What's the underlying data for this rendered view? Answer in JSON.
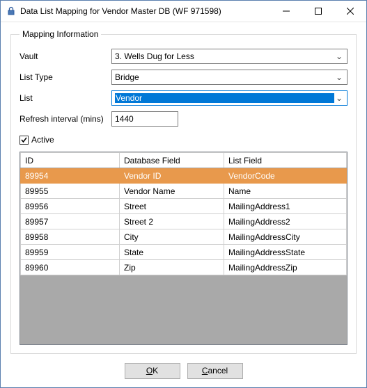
{
  "window": {
    "title": "Data List Mapping for Vendor Master DB (WF 971598)"
  },
  "group": {
    "legend": "Mapping Information"
  },
  "labels": {
    "vault": "Vault",
    "listType": "List Type",
    "list": "List",
    "refresh": "Refresh interval (mins)",
    "active": "Active"
  },
  "values": {
    "vault": "3. Wells Dug for Less",
    "listType": "Bridge",
    "list": "Vendor",
    "refresh": "1440",
    "active": true
  },
  "table": {
    "headers": {
      "id": "ID",
      "db": "Database Field",
      "lf": "List Field"
    },
    "rows": [
      {
        "id": "89954",
        "db": "Vendor ID",
        "lf": "VendorCode",
        "selected": true
      },
      {
        "id": "89955",
        "db": "Vendor Name",
        "lf": "Name",
        "selected": false
      },
      {
        "id": "89956",
        "db": "Street",
        "lf": "MailingAddress1",
        "selected": false
      },
      {
        "id": "89957",
        "db": "Street 2",
        "lf": "MailingAddress2",
        "selected": false
      },
      {
        "id": "89958",
        "db": "City",
        "lf": "MailingAddressCity",
        "selected": false
      },
      {
        "id": "89959",
        "db": "State",
        "lf": "MailingAddressState",
        "selected": false
      },
      {
        "id": "89960",
        "db": "Zip",
        "lf": "MailingAddressZip",
        "selected": false
      }
    ]
  },
  "buttons": {
    "ok": "OK",
    "cancel": "Cancel"
  }
}
